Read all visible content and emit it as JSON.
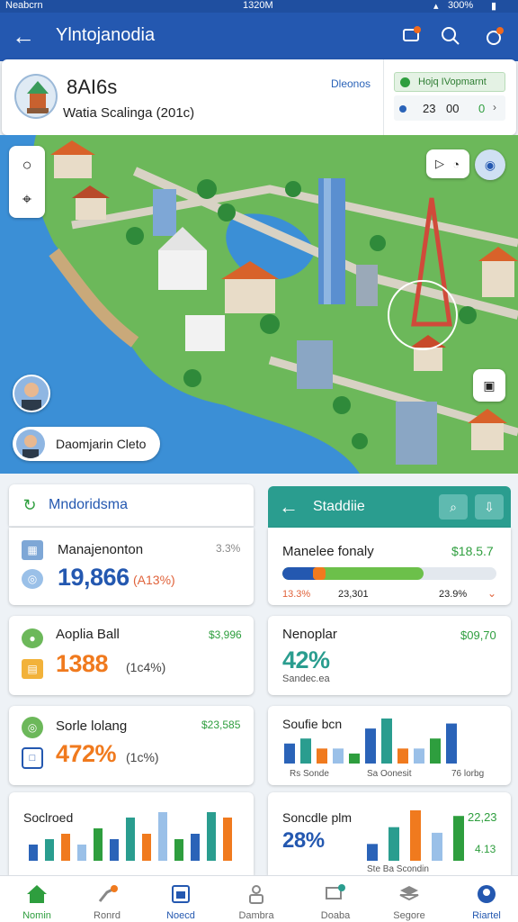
{
  "status": {
    "carrier": "Neabcrn",
    "time": "1320M",
    "battery": "300%"
  },
  "appbar": {
    "title": "Ylntojanodia"
  },
  "info": {
    "name": "8AI6s",
    "subtitle": "Watia Scalinga (201c)",
    "link": "Dleonos",
    "badge": "Hojq IVopmarnt",
    "stat1": "23",
    "stat2": "00",
    "stat3": "0"
  },
  "map": {
    "user_label": "Daomjarin Cleto"
  },
  "left_header": {
    "title": "Mndoridsma"
  },
  "right_header": {
    "title": "Staddiie"
  },
  "cards": {
    "c1": {
      "title": "Manajenonton",
      "small": "3.3%",
      "value": "19,866",
      "sub": "(A13%)"
    },
    "c2": {
      "title": "Aoplia Ball",
      "small": "$3,996",
      "value": "1388",
      "sub": "(1c4%)"
    },
    "c3": {
      "title": "Sorle lolang",
      "small": "$23,585",
      "value": "472%",
      "sub": "(1c%)"
    },
    "c4": {
      "title": "Soclroed"
    },
    "r1": {
      "title": "Manelee fonaly",
      "small": "$18.5.7",
      "l1": "13.3%",
      "l2": "23,301",
      "l3": "23.9%"
    },
    "r2": {
      "title": "Nenoplar",
      "small": "$09,70",
      "value": "42%",
      "sub": "Sandec.ea"
    },
    "r3": {
      "title": "Soufie bcn",
      "l1": "Rs Sonde",
      "l2": "Sa Oonesit",
      "l3": "76 lorbg"
    },
    "r4": {
      "title": "Soncdle plm",
      "small": "22,23",
      "value": "28%",
      "small2": "4.13",
      "sub": "Ste Ba Scondin"
    }
  },
  "progress": 0.66,
  "colors": {
    "primary": "#2458b0",
    "green": "#2e9e3e",
    "orange": "#f07a1e",
    "blue": "#2a63b8",
    "teal": "#2a9d8f"
  },
  "nav": [
    "Nomin",
    "Ronrd",
    "Noecd",
    "Dambra",
    "Doaba",
    "Segore",
    "Riartel"
  ],
  "chart_data": [
    {
      "type": "bar",
      "values": [
        3,
        4,
        5,
        3,
        6,
        4,
        8,
        5,
        9,
        4,
        5,
        9,
        8
      ]
    },
    {
      "type": "bar",
      "values": [
        4,
        5,
        3,
        3,
        2,
        7,
        9,
        3,
        3,
        5,
        8
      ]
    },
    {
      "type": "bar",
      "values": [
        3,
        6,
        9,
        5,
        8
      ]
    }
  ]
}
